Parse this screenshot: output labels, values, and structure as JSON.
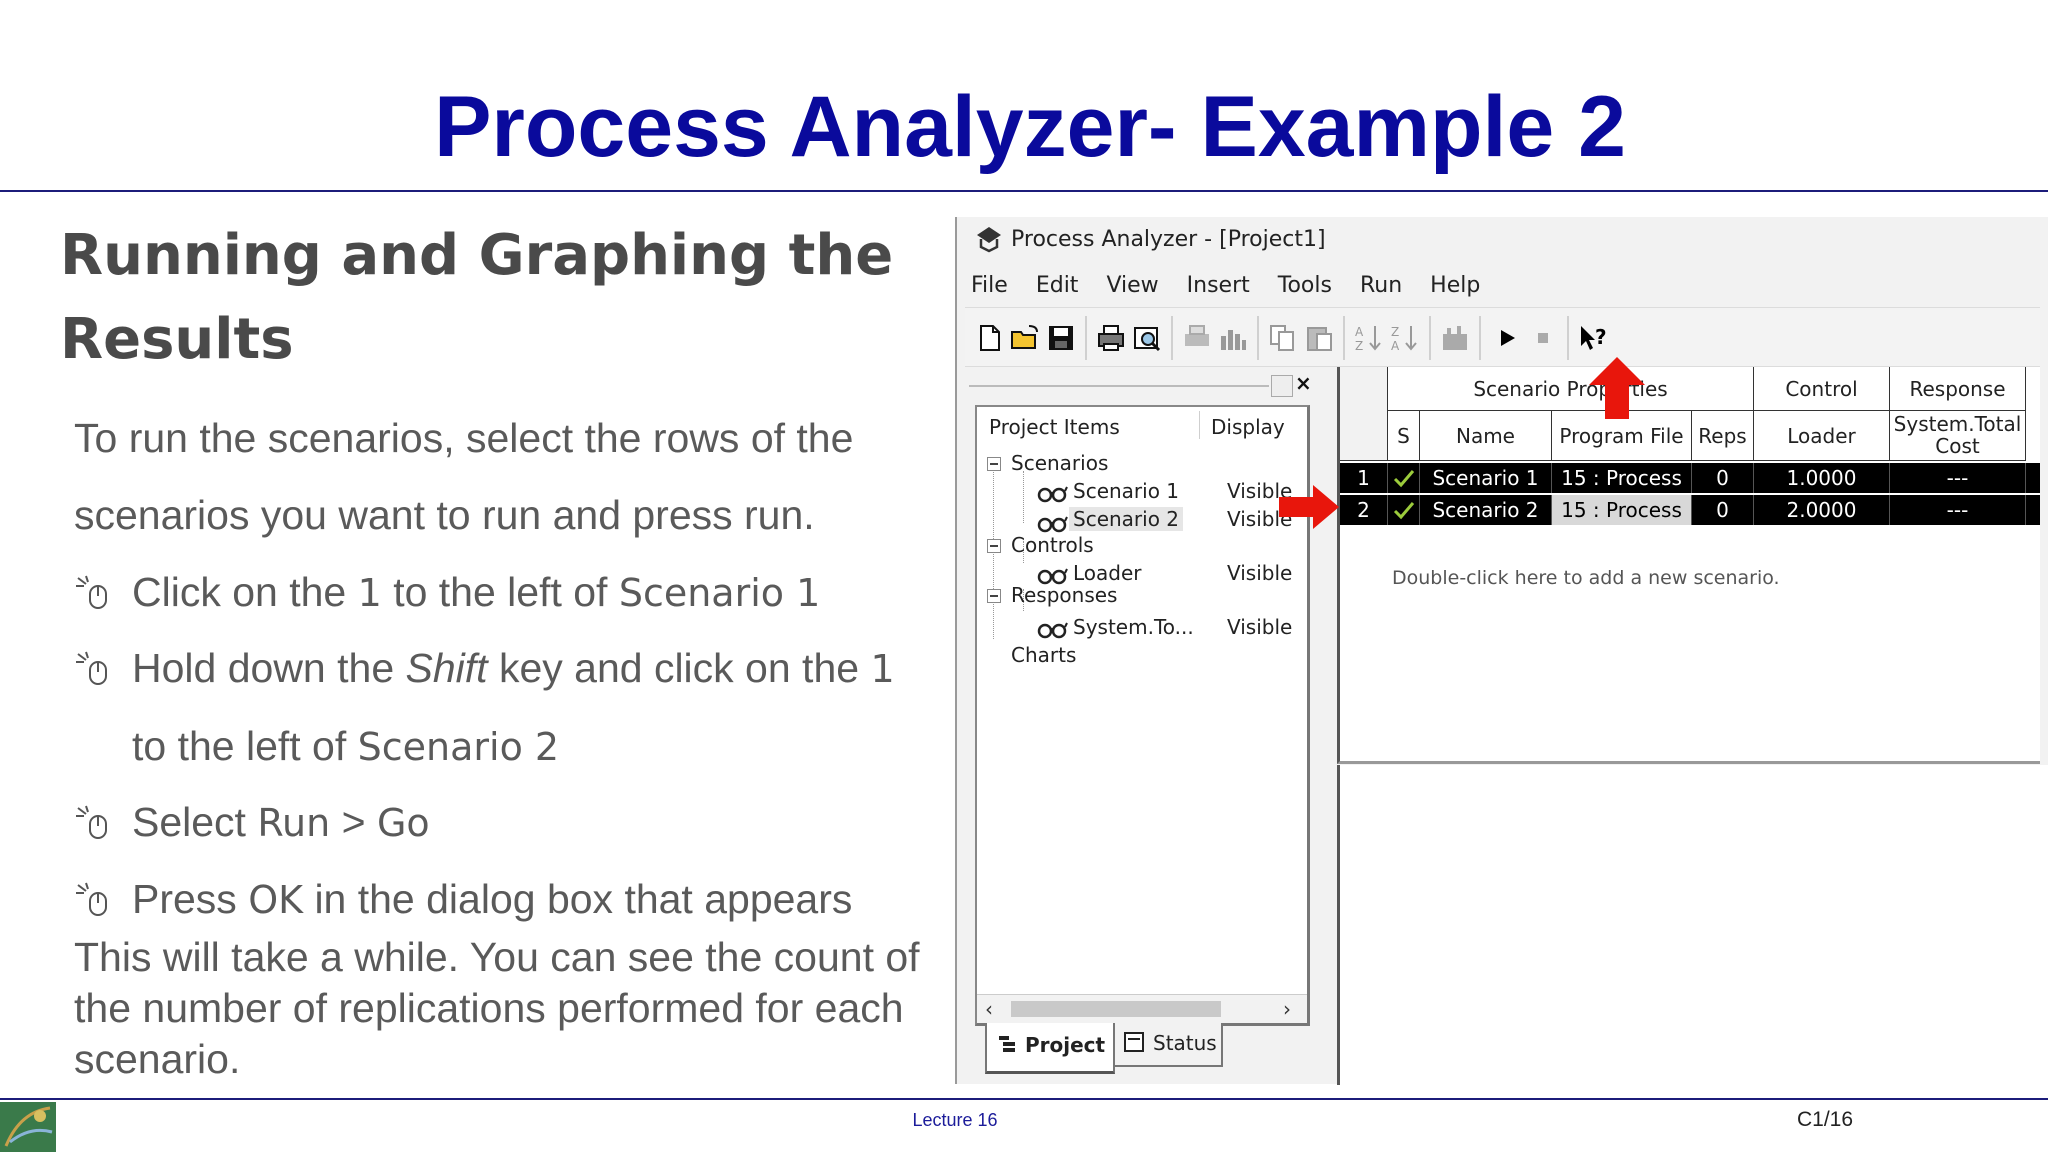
{
  "slide": {
    "title": "Process Analyzer- Example 2",
    "subtitle": "Running and Graphing the Results",
    "intro": "To run the scenarios, select the rows of the scenarios you want to run and press run.",
    "bullets": [
      {
        "pre": "Click on the ",
        "mono1": "1",
        "mid": " to the left of ",
        "mono2": "Scenario 1",
        "post": ""
      },
      {
        "pre": "Hold down the ",
        "italic": "Shift",
        "mid": " key and click on the ",
        "mono1": "1",
        "line2pre": "to the left of ",
        "mono2": "Scenario 2"
      },
      {
        "pre": "Select ",
        "mono1": "Run",
        "mid": " > ",
        "mono2": "Go"
      },
      {
        "pre": "Press ",
        "mono1": "OK",
        "mid": " in the dialog box that appears"
      }
    ],
    "closing": "This will take a while. You can see the count of the number of replications performed for each scenario.",
    "footer_center": "Lecture 16",
    "footer_right": "C1/16"
  },
  "app": {
    "window_title": "Process Analyzer - [Project1]",
    "menu": [
      "File",
      "Edit",
      "View",
      "Insert",
      "Tools",
      "Run",
      "Help"
    ],
    "toolbar_icons": [
      "new-icon",
      "open-icon",
      "save-icon",
      "print-icon",
      "print-preview-icon",
      "disabled-print-icon",
      "chart-icon",
      "copy-icon",
      "paste-icon",
      "sort-ascending-icon",
      "sort-descending-icon",
      "disabled-chart-icon",
      "run-icon",
      "stop-icon",
      "help-pointer-icon"
    ],
    "tree": {
      "col_items": "Project Items",
      "col_display": "Display",
      "nodes": [
        {
          "label": "Scenarios",
          "level": 0,
          "display": ""
        },
        {
          "label": "Scenario 1",
          "level": 1,
          "display": "Visible"
        },
        {
          "label": "Scenario 2",
          "level": 1,
          "display": "Visible"
        },
        {
          "label": "Controls",
          "level": 0,
          "display": ""
        },
        {
          "label": "Loader",
          "level": 1,
          "display": "Visible"
        },
        {
          "label": "Responses",
          "level": 0,
          "display": ""
        },
        {
          "label": "System.To...",
          "level": 1,
          "display": "Visible"
        },
        {
          "label": "Charts",
          "level": 0,
          "display": ""
        }
      ]
    },
    "tabs": {
      "project": "Project",
      "status": "Status"
    },
    "grid": {
      "group_scenario": "Scenario Properties",
      "group_control": "Control",
      "group_response": "Response",
      "col_s": "S",
      "col_name": "Name",
      "col_program": "Program File",
      "col_reps": "Reps",
      "col_loader": "Loader",
      "col_response": "System.Total Cost",
      "rows": [
        {
          "num": "1",
          "name": "Scenario 1",
          "program": "15 : Process",
          "reps": "0",
          "loader": "1.0000",
          "response": "---"
        },
        {
          "num": "2",
          "name": "Scenario 2",
          "program": "15 : Process",
          "reps": "0",
          "loader": "2.0000",
          "response": "---"
        }
      ],
      "hint": "Double-click here to add a new scenario."
    },
    "accent_red": "#e8160c"
  }
}
